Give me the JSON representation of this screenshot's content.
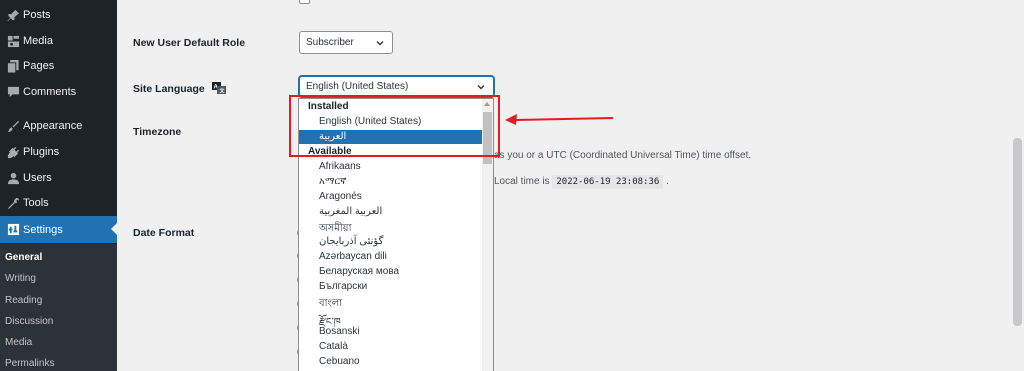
{
  "sidebar": {
    "items": [
      {
        "label": "Posts",
        "icon": "pin-icon"
      },
      {
        "label": "Media",
        "icon": "media-icon"
      },
      {
        "label": "Pages",
        "icon": "pages-icon"
      },
      {
        "label": "Comments",
        "icon": "comments-icon"
      },
      {
        "label": "Appearance",
        "icon": "brush-icon"
      },
      {
        "label": "Plugins",
        "icon": "plug-icon"
      },
      {
        "label": "Users",
        "icon": "user-icon"
      },
      {
        "label": "Tools",
        "icon": "wrench-icon"
      },
      {
        "label": "Settings",
        "icon": "settings-icon",
        "active": true
      }
    ],
    "submenu": [
      "General",
      "Writing",
      "Reading",
      "Discussion",
      "Media",
      "Permalinks"
    ],
    "submenu_current": "General"
  },
  "form": {
    "default_role_label": "New User Default Role",
    "default_role_value": "Subscriber",
    "site_language_label": "Site Language",
    "site_language_value": "English (United States)",
    "timezone_label": "Timezone",
    "timezone_desc": "as you or a UTC (Coordinated Universal Time) time offset.",
    "local_time_prefix": "Local time is",
    "local_time_value": "2022-06-19 23:08:36",
    "local_time_suffix": ".",
    "date_format_label": "Date Format"
  },
  "dropdown": {
    "installed_label": "Installed",
    "installed": [
      "English (United States)",
      "العربية"
    ],
    "selected": "العربية",
    "available_label": "Available",
    "available": [
      "Afrikaans",
      "አማርኛ",
      "Aragonés",
      "العربية المغربية",
      "অসমীয়া",
      "گؤنئی آذربایجان",
      "Azərbaycan dili",
      "Беларуская мова",
      "Български",
      "বাংলা",
      "རྫོང་ཁ",
      "Bosanski",
      "Català",
      "Cebuano"
    ]
  },
  "colors": {
    "sidebar_bg": "#1d2327",
    "active_blue": "#2271b1",
    "annotation_red": "#e11d22"
  }
}
